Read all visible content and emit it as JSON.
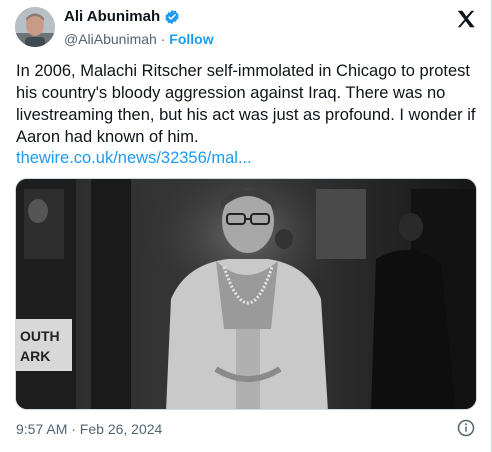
{
  "author": {
    "name": "Ali Abunimah",
    "handle": "@AliAbunimah",
    "separator": " · ",
    "follow_label": "Follow"
  },
  "tweet": {
    "text": "In 2006, Malachi Ritscher self-immolated in Chicago to protest his country's bloody aggression against Iraq. There was no livestreaming then, but his act was just as profound. I wonder if Aaron had known of him.",
    "link": "thewire.co.uk/news/32356/mal..."
  },
  "photo": {
    "sign_text_line1": "OUTH",
    "sign_text_line2": "ARK"
  },
  "footer": {
    "timestamp": "9:57 AM · Feb 26, 2024"
  },
  "colors": {
    "accent": "#1d9bf0",
    "text": "#0f1419",
    "muted": "#536471"
  },
  "icons": {
    "verified": "verified-badge-icon",
    "logo": "x-logo-icon",
    "info": "info-icon"
  }
}
